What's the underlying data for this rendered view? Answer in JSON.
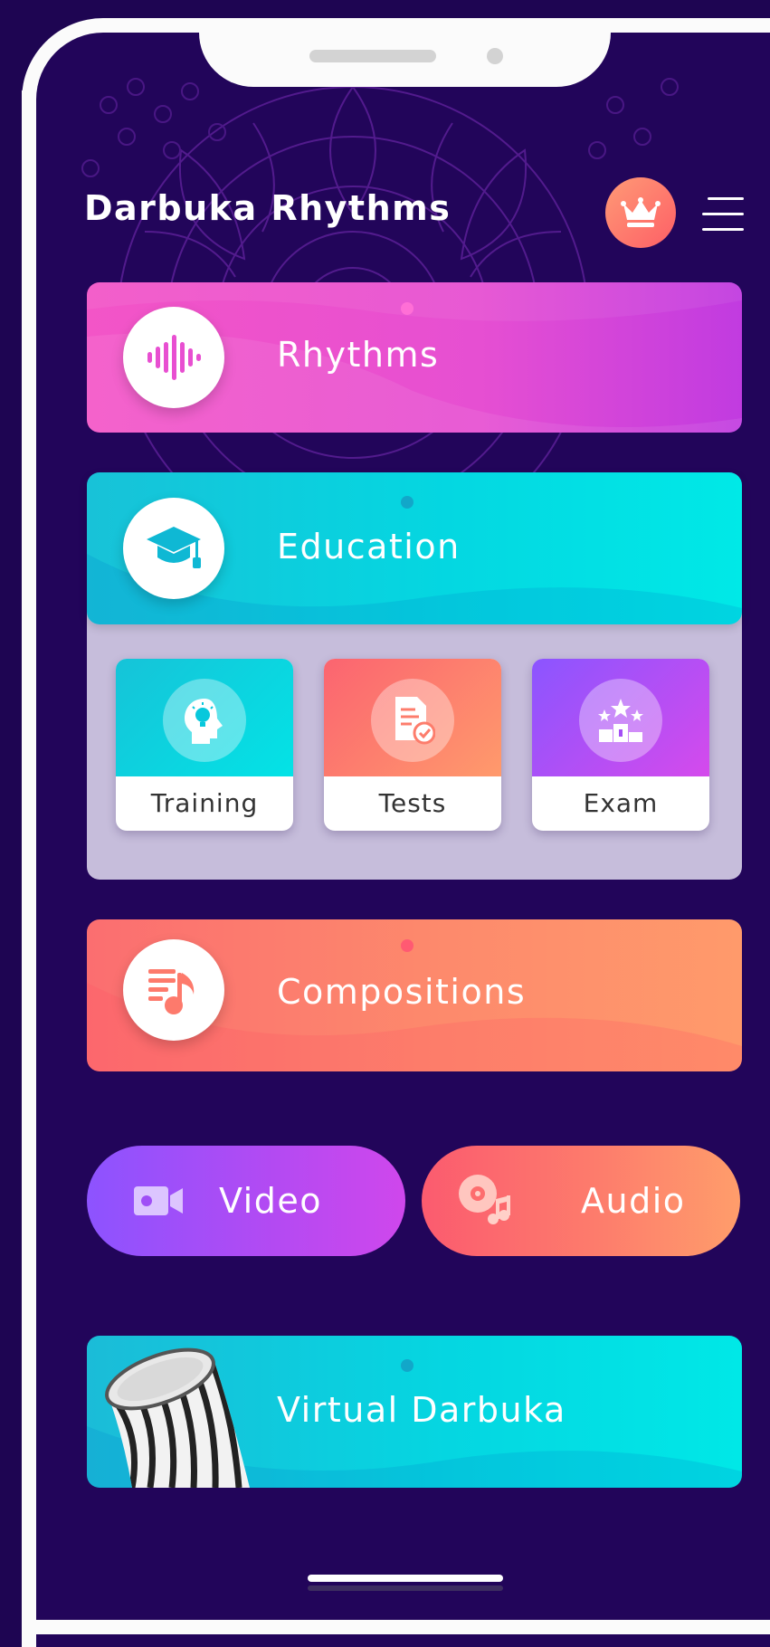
{
  "header": {
    "app_title": "Darbuka Rhythms",
    "premium_icon": "crown-icon",
    "menu_icon": "hamburger-menu-icon"
  },
  "cards": {
    "rhythms": {
      "label": "Rhythms",
      "icon": "sound-wave-icon"
    },
    "education": {
      "label": "Education",
      "icon": "graduation-cap-icon"
    },
    "compositions": {
      "label": "Compositions",
      "icon": "music-list-icon"
    },
    "virtual_darbuka": {
      "label": "Virtual Darbuka",
      "icon": "darbuka-drum-image"
    }
  },
  "education_sub": [
    {
      "label": "Training",
      "icon": "head-lightbulb-icon"
    },
    {
      "label": "Tests",
      "icon": "document-check-icon"
    },
    {
      "label": "Exam",
      "icon": "podium-stars-icon"
    }
  ],
  "media": {
    "video": {
      "label": "Video",
      "icon": "video-camera-icon"
    },
    "audio": {
      "label": "Audio",
      "icon": "disc-music-icon"
    }
  },
  "colors": {
    "background": "#22055a",
    "rhythms": "#e64fd2",
    "education": "#04d7e1",
    "compositions": "#fd8a6c",
    "video": "#b44af2",
    "audio": "#fd7c6c",
    "accent_crown": "#fd5f66"
  }
}
